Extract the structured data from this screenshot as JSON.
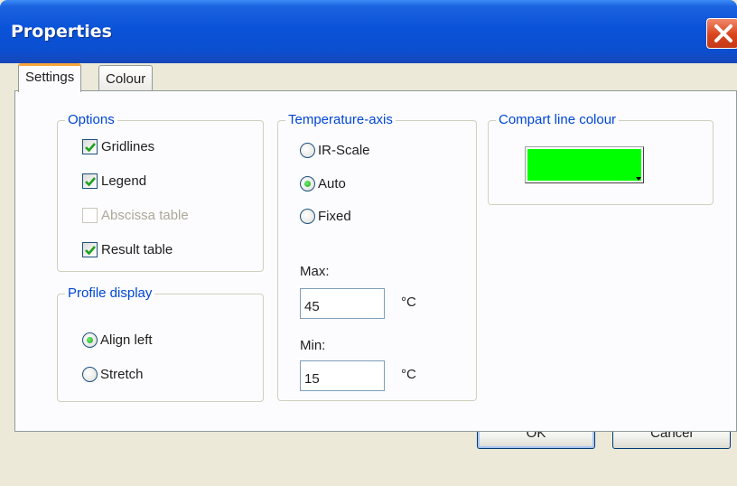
{
  "window": {
    "title": "Properties"
  },
  "tabs": [
    {
      "label": "Settings",
      "selected": true
    },
    {
      "label": "Colour",
      "selected": false
    }
  ],
  "options": {
    "legend": "Options",
    "items": [
      {
        "label": "Gridlines",
        "checked": true,
        "enabled": true
      },
      {
        "label": "Legend",
        "checked": true,
        "enabled": true
      },
      {
        "label": "Abscissa table",
        "checked": false,
        "enabled": false
      },
      {
        "label": "Result table",
        "checked": true,
        "enabled": true
      }
    ]
  },
  "profile_display": {
    "legend": "Profile display",
    "items": [
      {
        "label": "Align left",
        "selected": true
      },
      {
        "label": "Stretch",
        "selected": false
      }
    ]
  },
  "temperature_axis": {
    "legend": "Temperature-axis",
    "items": [
      {
        "label": "IR-Scale",
        "selected": false
      },
      {
        "label": "Auto",
        "selected": true
      },
      {
        "label": "Fixed",
        "selected": false
      }
    ],
    "max_label": "Max:",
    "max_value": "45",
    "min_label": "Min:",
    "min_value": "15",
    "unit": "°C"
  },
  "compart_line_colour": {
    "legend": "Compart line colour",
    "color": "#00ff00"
  },
  "buttons": {
    "ok": "OK",
    "cancel": "Cancel"
  }
}
